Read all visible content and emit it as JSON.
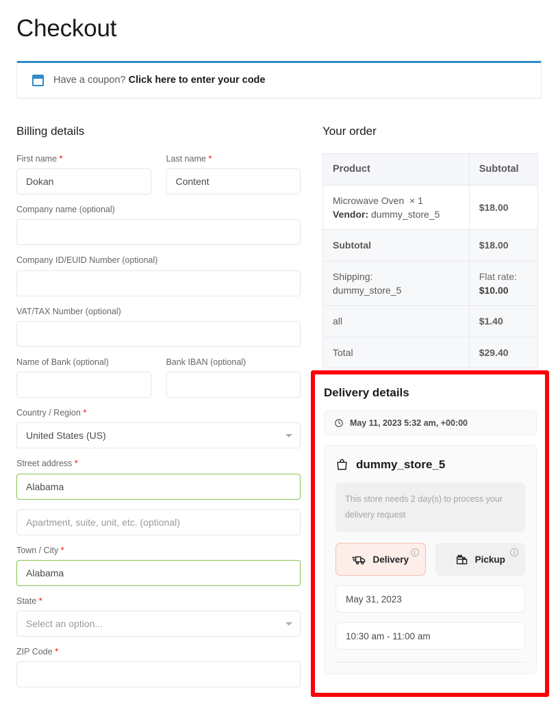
{
  "page_title": "Checkout",
  "coupon": {
    "icon": "coupon-tag-icon",
    "text": "Have a coupon?",
    "link": "Click here to enter your code"
  },
  "billing": {
    "section_title": "Billing details",
    "required_mark": "*",
    "fields": {
      "first_name": {
        "label": "First name",
        "value": "Dokan",
        "required": true
      },
      "last_name": {
        "label": "Last name",
        "value": "Content",
        "required": true
      },
      "company_name": {
        "label": "Company name (optional)",
        "value": "",
        "required": false
      },
      "company_id": {
        "label": "Company ID/EUID Number (optional)",
        "value": "",
        "required": false
      },
      "vat_tax": {
        "label": "VAT/TAX Number (optional)",
        "value": "",
        "required": false
      },
      "bank_name": {
        "label": "Name of Bank (optional)",
        "value": "",
        "required": false
      },
      "bank_iban": {
        "label": "Bank IBAN (optional)",
        "value": "",
        "required": false
      },
      "country": {
        "label": "Country / Region",
        "value": "United States (US)",
        "required": true
      },
      "street_address": {
        "label": "Street address",
        "value": "Alabama",
        "required": true,
        "valid": true
      },
      "apartment": {
        "label": "",
        "placeholder": "Apartment, suite, unit, etc. (optional)",
        "value": "",
        "required": false
      },
      "town_city": {
        "label": "Town / City",
        "value": "Alabama",
        "required": true,
        "valid": true
      },
      "state": {
        "label": "State",
        "value": "Select an option...",
        "required": true
      },
      "zip_code": {
        "label": "ZIP Code",
        "value": "",
        "required": true
      }
    }
  },
  "order": {
    "section_title": "Your order",
    "columns": [
      "Product",
      "Subtotal"
    ],
    "rows": [
      {
        "label": "Microwave Oven",
        "qty": "× 1",
        "vendor_label": "Vendor:",
        "vendor": "dummy_store_5",
        "value": "$18.00",
        "type": "product"
      },
      {
        "label": "Subtotal",
        "value": "$18.00",
        "type": "line"
      },
      {
        "label": "Shipping:",
        "label2": "dummy_store_5",
        "value_label": "Flat rate:",
        "value": "$10.00",
        "type": "shipping"
      },
      {
        "label": "all",
        "value": "$1.40",
        "type": "line"
      },
      {
        "label": "Total",
        "value": "$29.40",
        "type": "line"
      }
    ]
  },
  "delivery": {
    "section_title": "Delivery details",
    "timestamp": "May 11, 2023 5:32 am, +00:00",
    "timestamp_icon": "clock-icon",
    "store_icon": "shopping-bag-icon",
    "store_name": "dummy_store_5",
    "notice": "This store needs 2 day(s) to process your delivery request",
    "modes": [
      {
        "label": "Delivery",
        "icon": "delivery-truck-icon",
        "selected": true,
        "info_icon": "info-icon"
      },
      {
        "label": "Pickup",
        "icon": "store-pickup-icon",
        "selected": false,
        "info_icon": "info-icon"
      }
    ],
    "date_value": "May 31, 2023",
    "time_value": "10:30 am - 11:00 am"
  },
  "colors": {
    "accent_blue": "#2e8bc9",
    "highlight_red": "#fb0007",
    "valid_green": "#83c44e",
    "selected_pink_bg": "#fdeeea",
    "selected_pink_border": "#f3bfb2",
    "required_red": "#ff0000"
  }
}
